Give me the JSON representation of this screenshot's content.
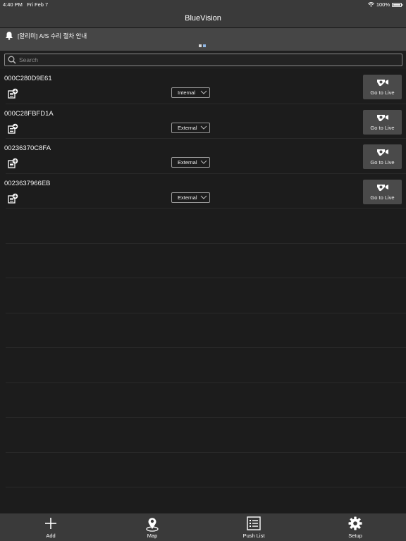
{
  "status": {
    "time": "4:40 PM",
    "date": "Fri Feb 7",
    "battery": "100%"
  },
  "app": {
    "title": "BlueVision"
  },
  "notice": {
    "text": "[알리미] A/S 수리 절차 안내",
    "page_count": 2,
    "active_page": 2
  },
  "search": {
    "placeholder": "Search"
  },
  "devices": [
    {
      "id": "000C280D9E61",
      "mode": "Internal",
      "action": "Go to Live"
    },
    {
      "id": "000C28FBFD1A",
      "mode": "External",
      "action": "Go to Live"
    },
    {
      "id": "00236370C8FA",
      "mode": "External",
      "action": "Go to Live"
    },
    {
      "id": "0023637966EB",
      "mode": "External",
      "action": "Go to Live"
    }
  ],
  "tabs": [
    {
      "label": "Add",
      "icon": "plus-icon"
    },
    {
      "label": "Map",
      "icon": "map-pin-icon"
    },
    {
      "label": "Push List",
      "icon": "list-icon"
    },
    {
      "label": "Setup",
      "icon": "gear-icon"
    }
  ],
  "colors": {
    "background": "#1c1c1c",
    "bars": "#3a3a3a",
    "notice": "#464646",
    "button": "#4a4a4a",
    "dot_active": "#8fb7e6"
  }
}
